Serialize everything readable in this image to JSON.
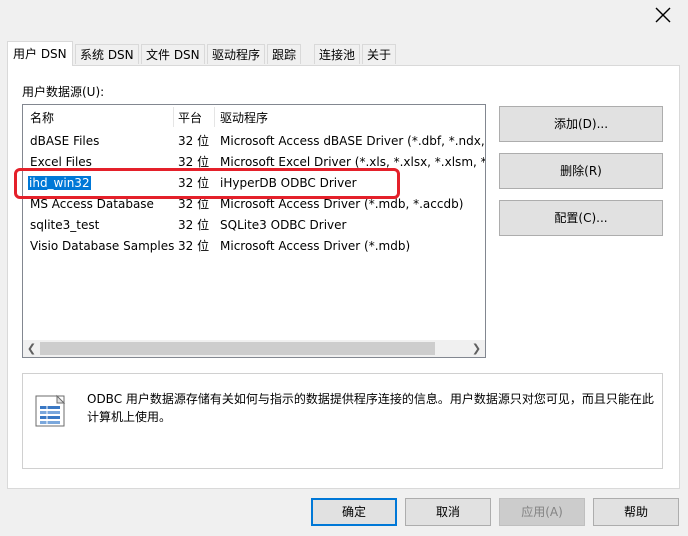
{
  "window": {
    "close_glyph": "✕"
  },
  "tabs": [
    {
      "label": "用户 DSN",
      "active": true
    },
    {
      "label": "系统 DSN"
    },
    {
      "label": "文件 DSN"
    },
    {
      "label": "驱动程序"
    },
    {
      "label": "跟踪"
    },
    {
      "label": "连接池"
    },
    {
      "label": "关于"
    }
  ],
  "user_ds": {
    "label": "用户数据源(U):",
    "columns": {
      "name": "名称",
      "platform": "平台",
      "driver": "驱动程序"
    },
    "rows": [
      {
        "name": "dBASE Files",
        "platform": "32 位",
        "driver": "Microsoft Access dBASE Driver (*.dbf, *.ndx, *"
      },
      {
        "name": "Excel Files",
        "platform": "32 位",
        "driver": "Microsoft Excel Driver (*.xls, *.xlsx, *.xlsm, *.xls"
      },
      {
        "name": "ihd_win32",
        "platform": "32 位",
        "driver": "iHyperDB ODBC Driver",
        "selected": true
      },
      {
        "name": "MS Access Database",
        "platform": "32 位",
        "driver": "Microsoft Access Driver (*.mdb, *.accdb)"
      },
      {
        "name": "sqlite3_test",
        "platform": "32 位",
        "driver": "SQLite3 ODBC Driver"
      },
      {
        "name": "Visio Database Samples",
        "platform": "32 位",
        "driver": "Microsoft Access Driver (*.mdb)"
      }
    ]
  },
  "side_buttons": {
    "add": "添加(D)...",
    "remove": "删除(R)",
    "configure": "配置(C)..."
  },
  "info": {
    "text": "ODBC 用户数据源存储有关如何与指示的数据提供程序连接的信息。用户数据源只对您可见，而且只能在此计算机上使用。",
    "icon": "datasource-icon"
  },
  "footer": {
    "ok": "确定",
    "cancel": "取消",
    "apply": "应用(A)",
    "help": "帮助"
  },
  "colors": {
    "selection": "#0078d7",
    "highlight_box": "#e4202a"
  }
}
